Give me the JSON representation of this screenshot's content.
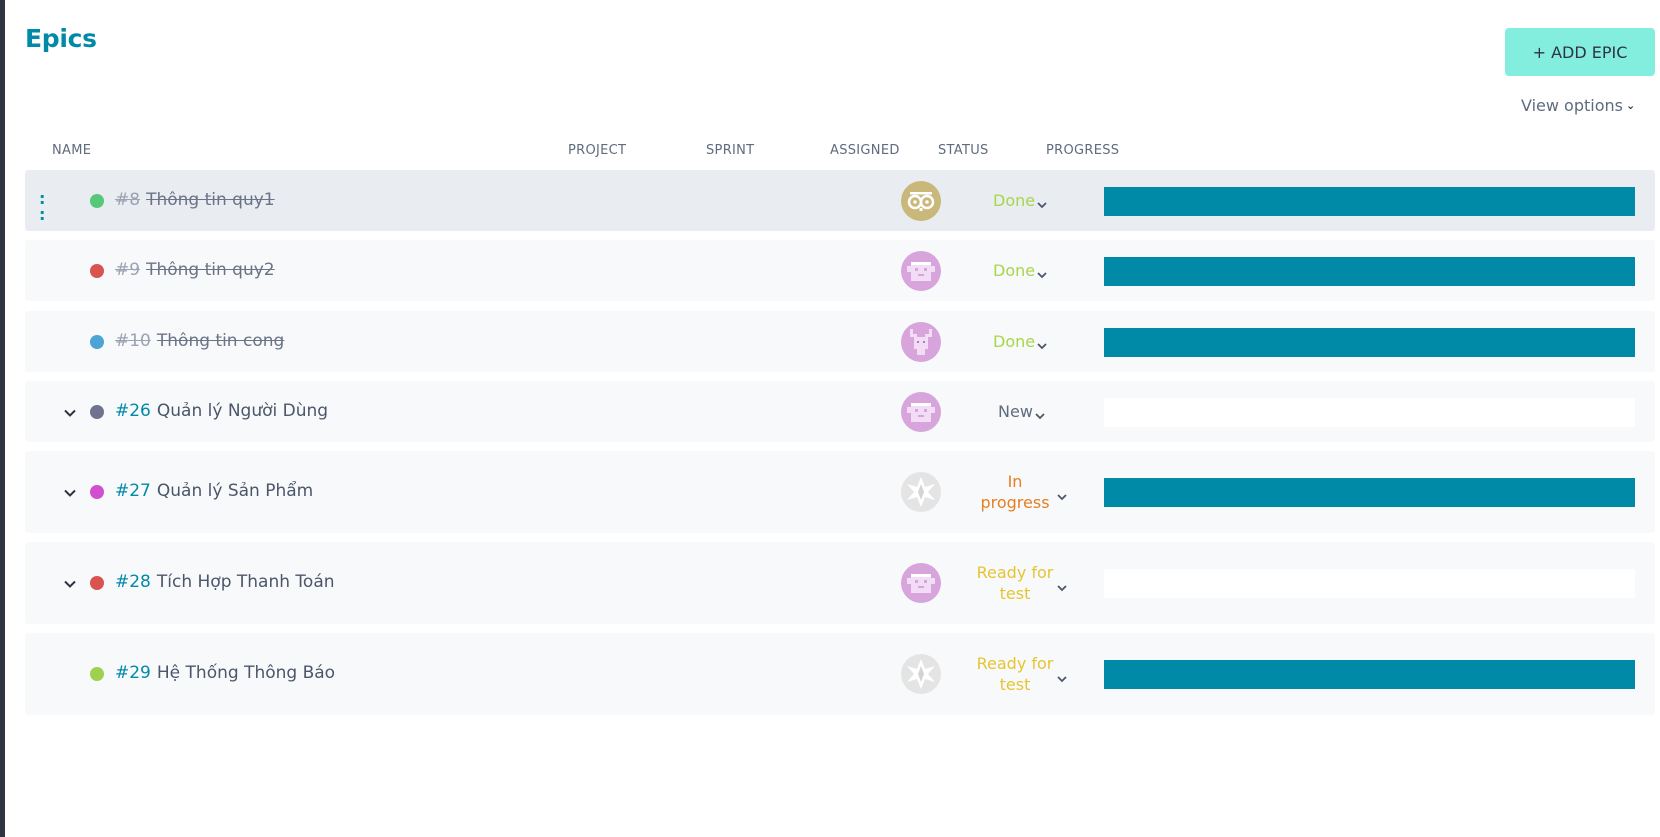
{
  "page": {
    "title": "Epics",
    "add_button": "+ ADD EPIC",
    "view_options": "View options"
  },
  "columns": [
    "NAME",
    "PROJECT",
    "SPRINT",
    "ASSIGNED",
    "STATUS",
    "PROGRESS"
  ],
  "colors": {
    "accent": "#008aa8",
    "add_button_bg": "#83eede",
    "status_done": "#a8d64b",
    "status_new": "#5f6b7e",
    "status_in_progress": "#e67e22",
    "status_ready_for_test": "#e5c531"
  },
  "epics": [
    {
      "ref": "#8",
      "title": "Thông tin quy1",
      "color": "#57c77a",
      "closed": true,
      "expandable": false,
      "status": "Done",
      "status_color": "#a8d64b",
      "progress": 1.0,
      "avatar": "owl-avatar-icon"
    },
    {
      "ref": "#9",
      "title": "Thông tin quy2",
      "color": "#d9534f",
      "closed": true,
      "expandable": false,
      "status": "Done",
      "status_color": "#a8d64b",
      "progress": 1.0,
      "avatar": "pixel-face-avatar-icon"
    },
    {
      "ref": "#10",
      "title": "Thông tin cong",
      "color": "#4ba3d6",
      "closed": true,
      "expandable": false,
      "status": "Done",
      "status_color": "#a8d64b",
      "progress": 1.0,
      "avatar": "deer-avatar-icon"
    },
    {
      "ref": "#26",
      "title": "Quản lý Người Dùng",
      "color": "#70728f",
      "closed": false,
      "expandable": true,
      "status": "New",
      "status_color": "#5f6b7e",
      "progress": 0.0,
      "avatar": "pixel-face-avatar-icon"
    },
    {
      "ref": "#27",
      "title": "Quản lý Sản Phẩm",
      "color": "#d14fd1",
      "closed": false,
      "expandable": true,
      "status": "In progress",
      "status_lines": [
        "In",
        "progress"
      ],
      "status_color": "#e67e22",
      "progress": 1.0,
      "avatar": "star-avatar-icon"
    },
    {
      "ref": "#28",
      "title": "Tích Hợp Thanh Toán",
      "color": "#d9534f",
      "closed": false,
      "expandable": true,
      "status": "Ready for test",
      "status_lines": [
        "Ready for",
        "test"
      ],
      "status_color": "#e5c531",
      "progress": 0.0,
      "avatar": "pixel-face-avatar-icon"
    },
    {
      "ref": "#29",
      "title": "Hệ Thống Thông Báo",
      "color": "#9ed24e",
      "closed": false,
      "expandable": false,
      "status": "Ready for test",
      "status_lines": [
        "Ready for",
        "test"
      ],
      "status_color": "#e5c531",
      "progress": 1.0,
      "avatar": "star-avatar-icon"
    }
  ]
}
